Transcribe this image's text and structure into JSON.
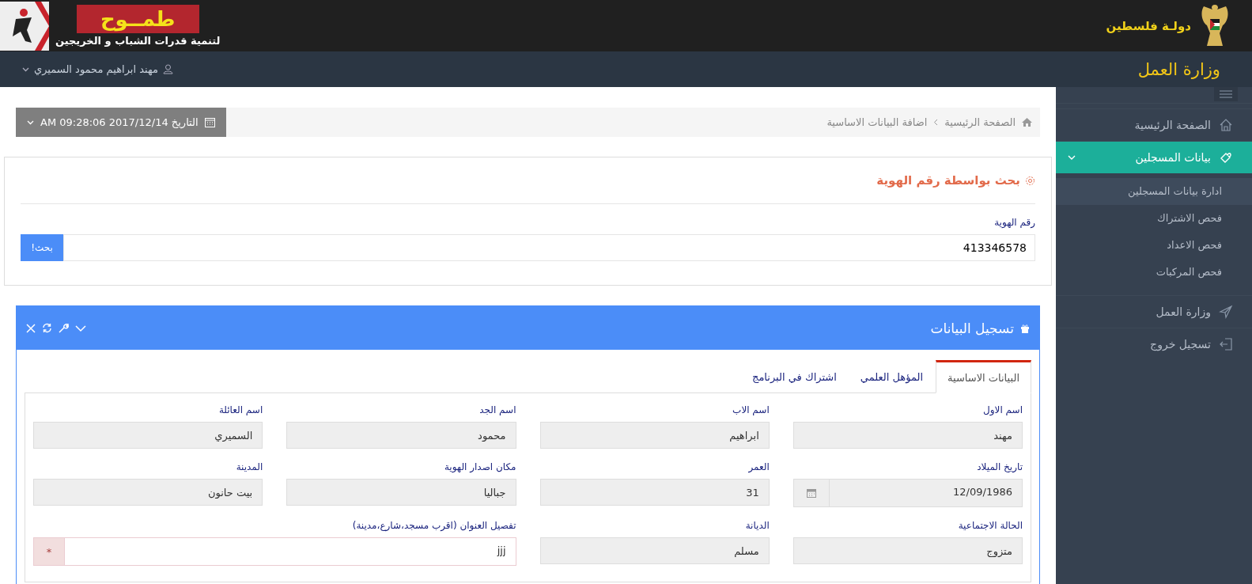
{
  "header": {
    "logo_title": "طمــوح",
    "logo_subtitle": "لتنمية قدرات الشباب و الخريجين",
    "state_name": "دولـة فلسطين"
  },
  "topbar": {
    "app_title": "وزارة العمل",
    "user_name": "مهند ابراهيم محمود السميري"
  },
  "breadcrumb": [
    "الصفحة الرئيسية",
    "اضافة البيانات الاساسية"
  ],
  "date_button": "التاريخ 2017/12/14 AM 09:28:06",
  "search_portlet": {
    "title": "بحث بواسطة رقم الهوية",
    "label": "رقم الهوية",
    "value": "413346578",
    "button": "بحث!"
  },
  "register_portlet": {
    "title": "تسجيل البيانات",
    "tabs": [
      {
        "label": "البيانات الاساسية",
        "selected": true
      },
      {
        "label": "المؤهل العلمي",
        "selected": false
      },
      {
        "label": "اشتراك في البرنامج",
        "selected": false
      }
    ],
    "fields": [
      {
        "kind": "text",
        "label": "اسم الاول",
        "value": "مهند"
      },
      {
        "kind": "text",
        "label": "اسم الاب",
        "value": "ابراهيم"
      },
      {
        "kind": "text",
        "label": "اسم الجد",
        "value": "محمود"
      },
      {
        "kind": "text",
        "label": "اسم العائلة",
        "value": "السميري"
      },
      {
        "kind": "date",
        "label": "تاريخ الميلاد",
        "value": "12/09/1986"
      },
      {
        "kind": "text",
        "label": "العمر",
        "value": "31"
      },
      {
        "kind": "text",
        "label": "مكان اصدار الهوية",
        "value": "جباليا"
      },
      {
        "kind": "text",
        "label": "المدينة",
        "value": "بيت حانون"
      },
      {
        "kind": "text",
        "label": "الحالة الاجتماعية",
        "value": "متزوج"
      },
      {
        "kind": "text",
        "label": "الديانة",
        "value": "مسلم"
      },
      {
        "kind": "required",
        "label": "تفصيل العنوان (اقرب مسجد،شارع،مدينة)",
        "value": "jjj",
        "addon": "*"
      }
    ]
  },
  "sidebar": {
    "items": [
      {
        "label": "الصفحة الرئيسية",
        "kind": "home",
        "selected": false
      },
      {
        "label": "بيانات المسجلين",
        "kind": "registrants",
        "selected": true,
        "expanded": true,
        "children": [
          {
            "label": "ادارة بيانات المسجلين",
            "selected": true
          },
          {
            "label": "فحص الاشتراك",
            "selected": false
          },
          {
            "label": "فحص الاعداد",
            "selected": false
          },
          {
            "label": "فحص المركبات",
            "selected": false
          }
        ]
      },
      {
        "label": "وزارة العمل",
        "kind": "ministry",
        "selected": false
      },
      {
        "label": "تسجيل خروج",
        "kind": "logout",
        "selected": false
      }
    ]
  }
}
